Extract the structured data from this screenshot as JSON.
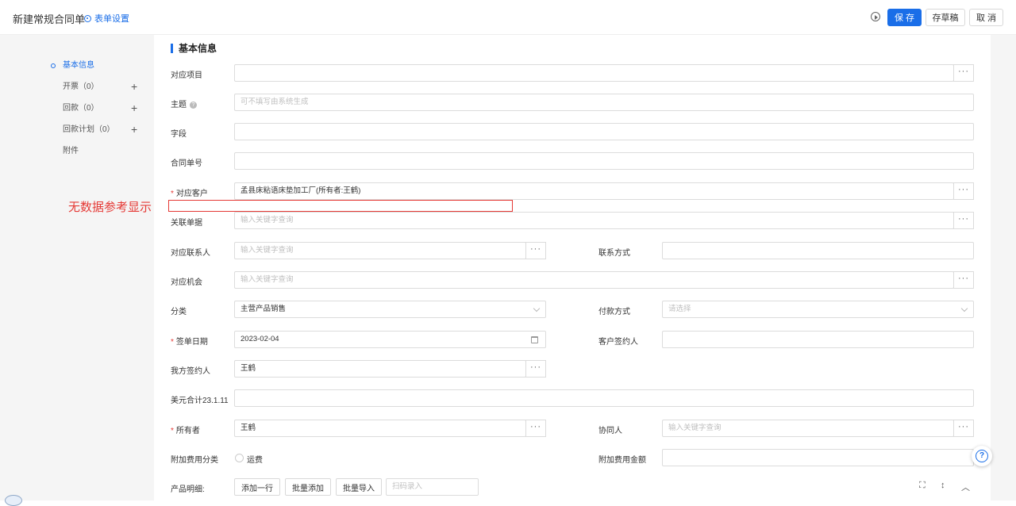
{
  "header": {
    "title": "新建常规合同单",
    "form_settings": "表单设置",
    "save": "保 存",
    "draft": "存草稿",
    "cancel": "取 消"
  },
  "nav": {
    "items": [
      {
        "label": "基本信息"
      },
      {
        "label": "开票（0）"
      },
      {
        "label": "回款（0）"
      },
      {
        "label": "回款计划（0）"
      },
      {
        "label": "附件"
      }
    ]
  },
  "section": {
    "title": "基本信息"
  },
  "annotation": {
    "text": "无数据参考显示"
  },
  "fields": {
    "project": {
      "label": "对应项目",
      "value": ""
    },
    "subject": {
      "label": "主题",
      "placeholder": "可不填写由系统生成"
    },
    "field": {
      "label": "字段",
      "value": ""
    },
    "contract_no": {
      "label": "合同单号",
      "value": ""
    },
    "customer": {
      "label": "对应客户",
      "value": "孟县床粘语床垫加工厂(所有者:王鹤)"
    },
    "related_doc": {
      "label": "关联单据",
      "placeholder": "输入关键字查询"
    },
    "contact": {
      "label": "对应联系人",
      "placeholder": "输入关键字查询"
    },
    "contact_method": {
      "label": "联系方式",
      "value": ""
    },
    "opportunity": {
      "label": "对应机会",
      "placeholder": "输入关键字查询"
    },
    "category": {
      "label": "分类",
      "value": "主营产品销售"
    },
    "payment": {
      "label": "付款方式",
      "placeholder": "请选择"
    },
    "sign_date": {
      "label": "签单日期",
      "value": "2023-02-04"
    },
    "customer_signer": {
      "label": "客户签约人",
      "value": ""
    },
    "our_signer": {
      "label": "我方签约人",
      "value": "王鹤"
    },
    "usd_total": {
      "label": "美元合计23.1.11",
      "value": ""
    },
    "owner": {
      "label": "所有者",
      "value": "王鹤"
    },
    "collaborator": {
      "label": "协同人",
      "placeholder": "输入关键字查询"
    },
    "extra_fee_type": {
      "label": "附加费用分类",
      "option": "运费"
    },
    "extra_fee_amount": {
      "label": "附加费用金额",
      "value": ""
    }
  },
  "products": {
    "label": "产品明细:",
    "add_row": "添加一行",
    "batch_add": "批量添加",
    "batch_import": "批量导入",
    "scan_placeholder": "扫码录入"
  },
  "colors": {
    "primary": "#1a6ee8",
    "required": "#e53935"
  }
}
